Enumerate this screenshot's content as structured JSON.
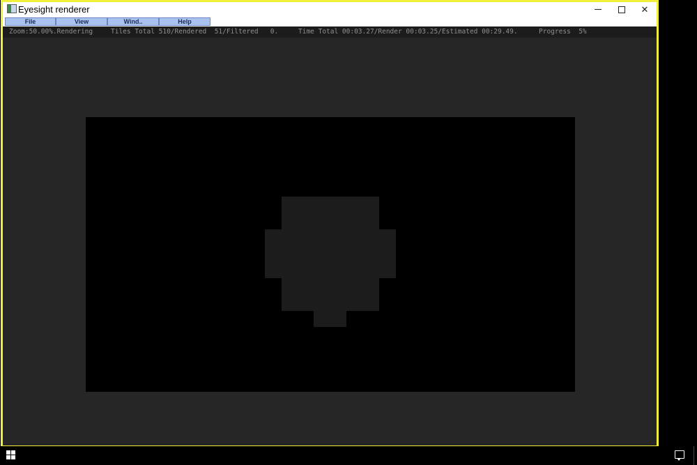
{
  "window": {
    "title": "Eyesight renderer",
    "frame_color": "#f2f03a"
  },
  "menu": {
    "items": [
      {
        "label": "File"
      },
      {
        "label": "View"
      },
      {
        "label": "Wind.."
      },
      {
        "label": "Help"
      }
    ]
  },
  "status": {
    "zoom": "Zoom:50.00%.Rendering",
    "tiles": "Tiles Total 510/Rendered  51/Filtered   0.",
    "time": "Time Total 00:03.27/Render 00:03.25/Estimated 00:29.49.",
    "progress": "Progress  5%"
  },
  "icons": {
    "app": "app-icon",
    "minimize": "minimize-icon",
    "maximize": "maximize-icon",
    "close": "close-icon",
    "start": "windows-start-icon",
    "notifications": "action-center-icon"
  },
  "colors": {
    "canvas_bg": "#262626",
    "render_bg": "#000000",
    "rendered_tiles": "#1c1c1c",
    "menu_bg": "#a9c2f0"
  }
}
